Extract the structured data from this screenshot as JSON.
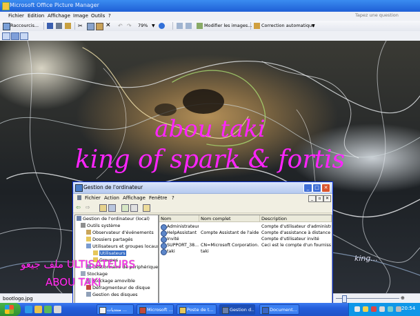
{
  "picture_manager": {
    "title": "Microsoft Office Picture Manager",
    "menu": [
      "Fichier",
      "Edition",
      "Affichage",
      "Image",
      "Outils",
      "?"
    ],
    "help_placeholder": "Tapez une question",
    "toolbar": {
      "shortcuts_label": "Raccourcis...",
      "zoom_value": "79%",
      "edit_images_label": "Modifier les images...",
      "auto_correct_label": "Correction automatique"
    },
    "status": {
      "filename": "bootlogo.jpg"
    }
  },
  "image": {
    "line1": "abou taki",
    "line2": "king of spark & fortis",
    "signature": "king..."
  },
  "computer_management": {
    "title": "Gestion de l'ordinateur",
    "menu": [
      "Fichier",
      "Action",
      "Affichage",
      "Fenêtre",
      "?"
    ],
    "tree": [
      "Gestion de l'ordinateur (local)",
      "Outils système",
      "Observateur d'événements",
      "Dossiers partagés",
      "Utilisateurs et groupes locaux",
      "Utilisateurs",
      "Groupes",
      "Gestionnaire de périphérique",
      "Stockage",
      "Stockage amovible",
      "Défragmenteur de disque",
      "Gestion des disques"
    ],
    "columns": [
      "Nom",
      "Nom complet",
      "Description"
    ],
    "users": [
      {
        "name": "Administrateur",
        "full": "",
        "desc": "Compte d'utilisateur d'administratio"
      },
      {
        "name": "HelpAssistant",
        "full": "Compte Assistant de l'aide...",
        "desc": "Compte d'assistance à distance"
      },
      {
        "name": "Invité",
        "full": "",
        "desc": "Compte d'utilisateur invité"
      },
      {
        "name": "SUPPORT_38...",
        "full": "CN=Microsoft Corporation...",
        "desc": "Ceci est le compte d'un fournisseur"
      },
      {
        "name": "taki",
        "full": "taki",
        "desc": ""
      }
    ]
  },
  "overlay": {
    "line1": "ULTISATEURS",
    "line1_prefix": "ملف جيعو",
    "line2": "ABOU TAKI"
  },
  "taskbar": {
    "tasks": [
      "منتديات ...",
      "Microsoft ...",
      "Poste de t...",
      "Gestion d...",
      "Document..."
    ],
    "clock": "20:54"
  },
  "colors": {
    "title_blue": "#1f5fd6",
    "accent_magenta": "#ff24ff",
    "taskbar_blue": "#245edb",
    "start_green": "#2f8f2f"
  }
}
